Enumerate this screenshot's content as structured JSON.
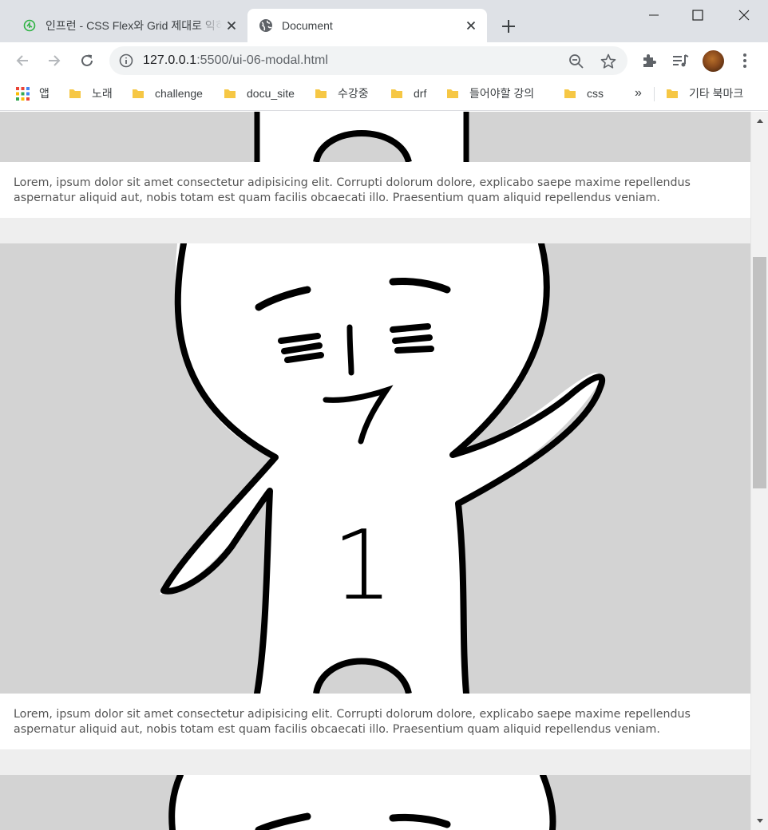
{
  "browser": {
    "tabs": [
      {
        "title": "인프런 - CSS Flex와 Grid 제대로 익히기",
        "favicon": "inflearn-icon",
        "active": false
      },
      {
        "title": "Document",
        "favicon": "globe-icon",
        "active": true
      }
    ],
    "new_tab_label": "+",
    "address": {
      "host": "127.0.0.1",
      "rest": ":5500/ui-06-modal.html"
    },
    "bookmarks": {
      "apps_label": "앱",
      "items": [
        "노래",
        "challenge",
        "docu_site",
        "수강중",
        "drf",
        "들어야할 강의",
        "css"
      ],
      "overflow_label": "»",
      "other_label": "기타 북마크"
    }
  },
  "page": {
    "card_text": "Lorem, ipsum dolor sit amet consectetur adipisicing elit. Corrupti dolorum dolore, explicabo saepe maxime repellendus aspernatur aliquid aut, nobis totam est quam facilis obcaecati illo. Praesentium quam aliquid repellendus veniam.",
    "cards": [
      {
        "text_key": "card_text"
      },
      {
        "text_key": "card_text"
      },
      {
        "text_key": "card_text"
      }
    ],
    "figure_label": "1"
  },
  "colors": {
    "tabstrip": "#dee1e6",
    "image_bg": "#d3d3d3",
    "page_bg": "#eeeeee",
    "text": "#555555",
    "folder": "#f6c744"
  }
}
